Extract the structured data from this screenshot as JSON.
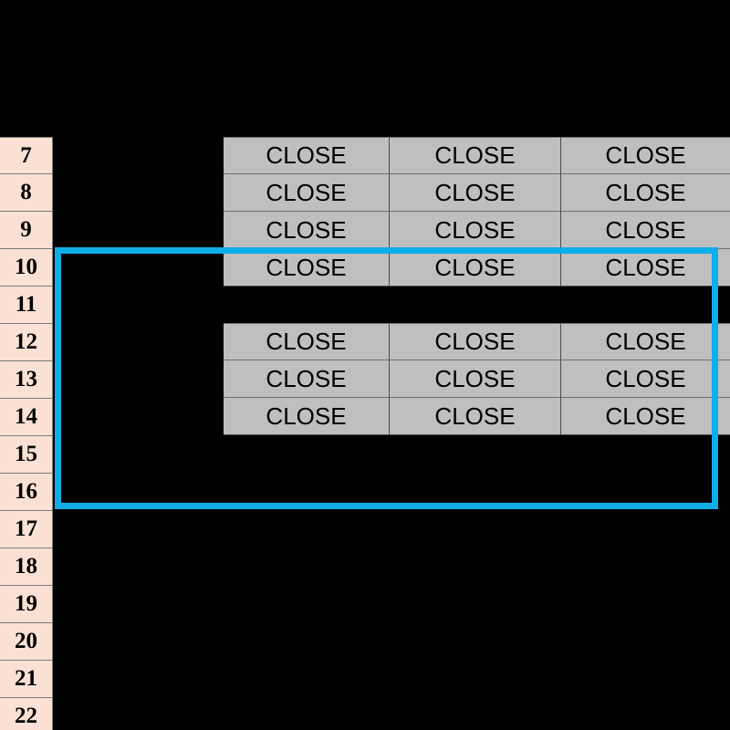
{
  "sheet": {
    "title": "Spreadsheet Selection View",
    "background_color": "#000000",
    "row_header_color": "#FBE1D4",
    "cell_color": "#BFBFBF",
    "selection_color": "#10AEE8",
    "row_headers": [
      "7",
      "8",
      "9",
      "10",
      "11",
      "12",
      "13",
      "14",
      "15",
      "16",
      "17",
      "18",
      "19",
      "20",
      "21",
      "22"
    ],
    "cell_blocks": [
      {
        "name": "upper-close-block",
        "start_row": "7",
        "end_row": "10",
        "rows": [
          [
            "CLOSE",
            "CLOSE",
            "CLOSE"
          ],
          [
            "CLOSE",
            "CLOSE",
            "CLOSE"
          ],
          [
            "CLOSE",
            "CLOSE",
            "CLOSE"
          ],
          [
            "CLOSE",
            "CLOSE",
            "CLOSE"
          ]
        ]
      },
      {
        "name": "lower-close-block",
        "start_row": "12",
        "end_row": "14",
        "rows": [
          [
            "CLOSE",
            "CLOSE",
            "CLOSE"
          ],
          [
            "CLOSE",
            "CLOSE",
            "CLOSE"
          ],
          [
            "CLOSE",
            "CLOSE",
            "CLOSE"
          ]
        ]
      }
    ],
    "selection": {
      "label": "selection-rectangle",
      "top_row": "10",
      "bottom_row": "16"
    }
  }
}
